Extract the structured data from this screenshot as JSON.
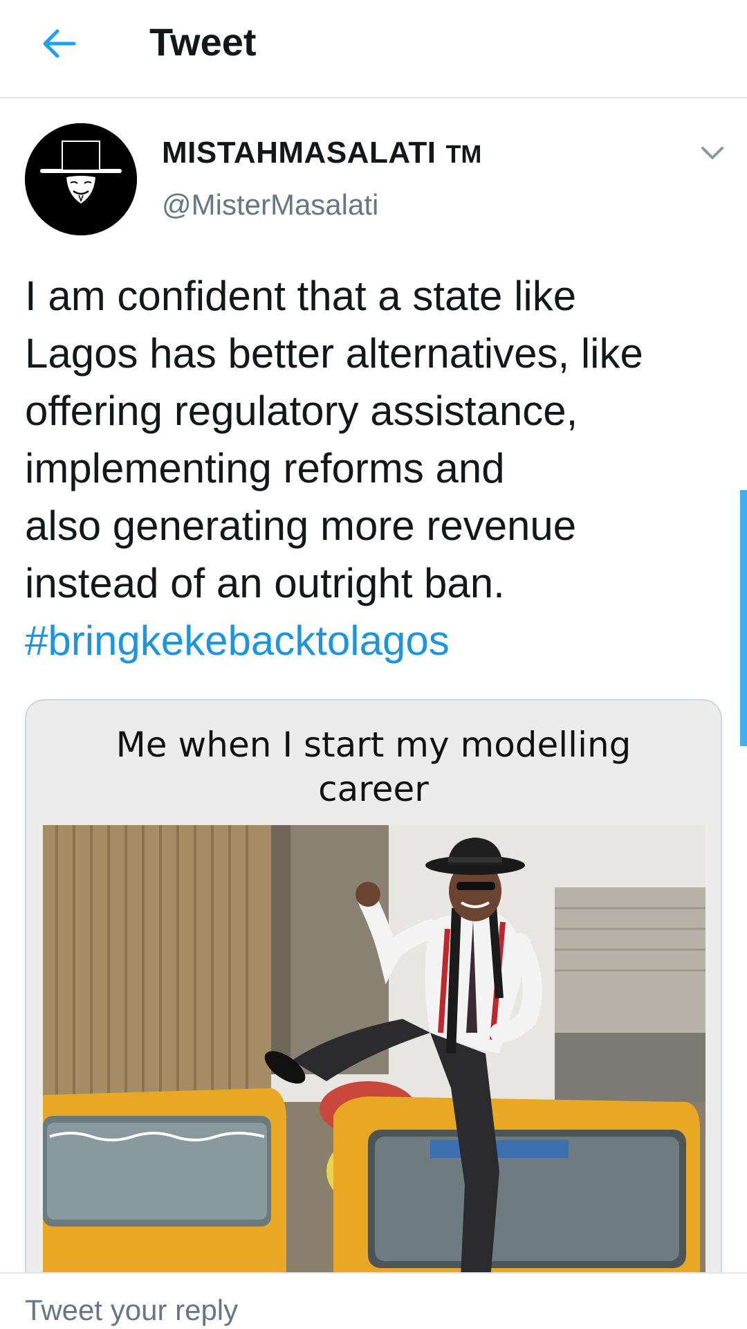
{
  "header": {
    "title": "Tweet",
    "back_icon": "arrow-left-icon"
  },
  "author": {
    "display_name": "MISTAHMASALATI",
    "trademark": "TM",
    "handle": "@MisterMasalati",
    "avatar_icon": "hat-mask-avatar",
    "menu_icon": "chevron-down-icon"
  },
  "tweet": {
    "lines": [
      "I am confident that a state like",
      "Lagos has better alternatives, like",
      "offering regulatory assistance,",
      "implementing reforms and",
      "also generating more revenue",
      "instead of an outright ban."
    ],
    "hashtag": "#bringkekebacktolagos"
  },
  "media": {
    "caption_line1": "Me when I start my modelling",
    "caption_line2": "career",
    "photo_description_icon": "meme-photo"
  },
  "reply": {
    "placeholder": "Tweet your reply"
  },
  "colors": {
    "accent": "#1da1f2",
    "hashtag": "#1b95e0",
    "secondary_text": "#657786"
  }
}
